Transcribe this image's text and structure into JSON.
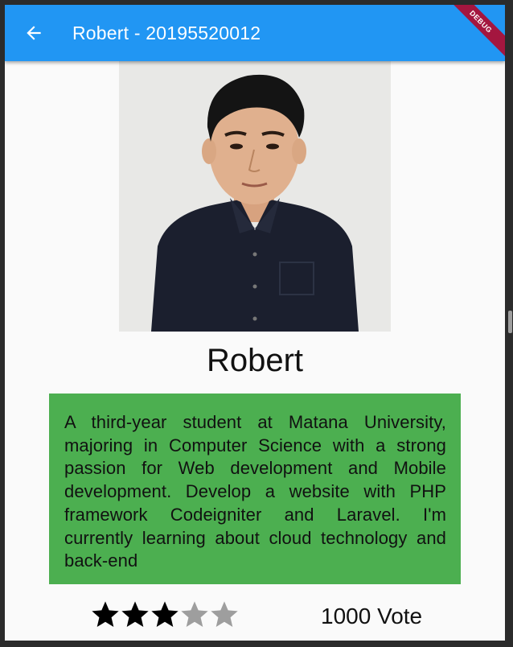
{
  "appbar": {
    "title": "Robert - 20195520012",
    "back_icon": "arrow-back-icon",
    "color": "#2196f3",
    "debug_banner": "DEBUG"
  },
  "profile": {
    "photo_icon": "profile-photo",
    "name": "Robert",
    "bio": "A third-year student at Matana University, majoring in Computer Science with a strong passion for Web development and Mobile development. Develop a website with PHP framework Codeigniter and Laravel. I'm currently learning about cloud technology and back-end",
    "bio_bg": "#4caf50"
  },
  "rating": {
    "stars_filled": 3,
    "stars_total": 5,
    "votes_label": "1000 Vote",
    "filled_color": "#000000",
    "empty_color": "#9e9e9e"
  }
}
